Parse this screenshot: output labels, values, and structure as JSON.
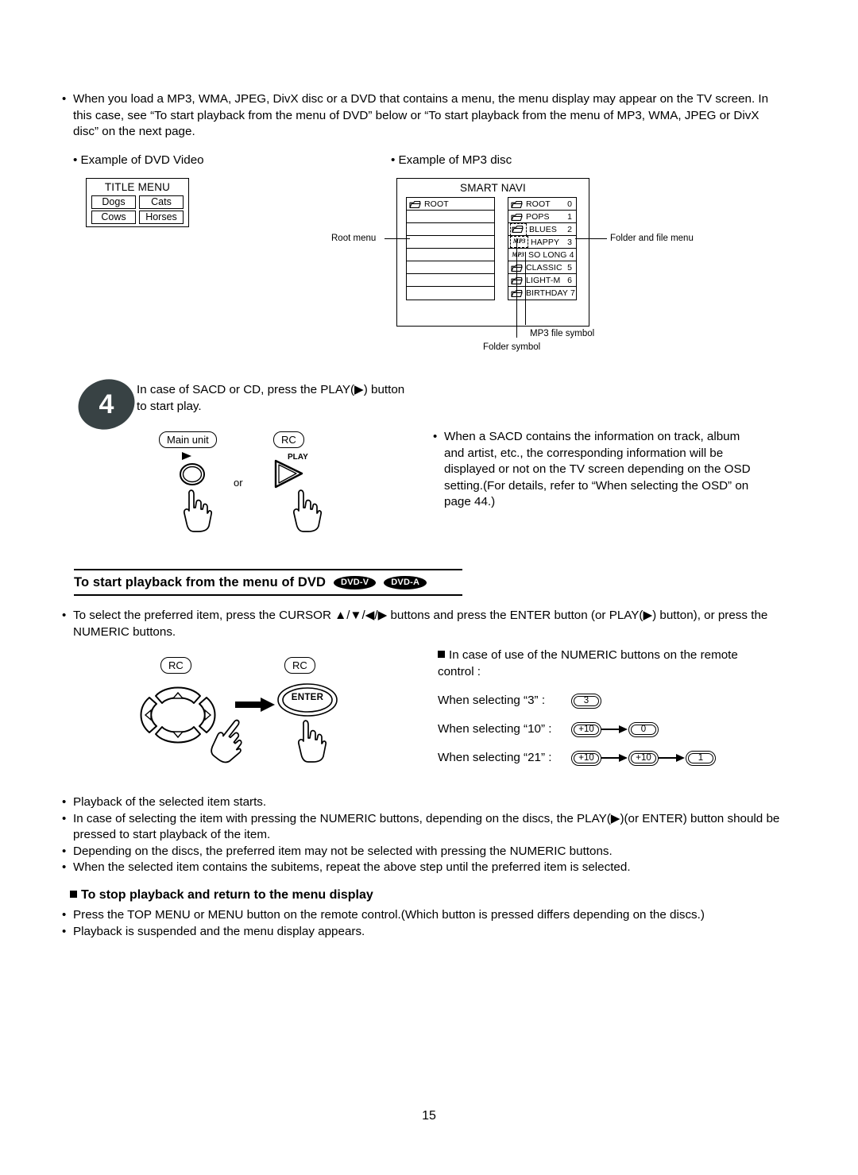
{
  "intro": {
    "bullet": "When you load a MP3, WMA, JPEG, DivX disc or a DVD that contains a menu, the menu display may appear on the TV screen. In this case, see “To start playback from the menu of DVD” below or “To start playback from the menu of MP3, WMA, JPEG or DivX disc” on the next page."
  },
  "examples": {
    "dvd_caption": "Example of DVD Video",
    "mp3_caption": "Example of MP3 disc"
  },
  "title_menu": {
    "heading": "TITLE MENU",
    "items": [
      "Dogs",
      "Cats",
      "Cows",
      "Horses"
    ]
  },
  "smart_navi": {
    "heading": "SMART NAVI",
    "root_menu_label": "Root menu",
    "folder_file_menu_label": "Folder and file menu",
    "mp3_file_symbol_label": "MP3 file symbol",
    "folder_symbol_label": "Folder symbol",
    "root_panel_rows": [
      {
        "label": "ROOT",
        "icon": "folder-icon"
      },
      {
        "label": "",
        "icon": ""
      },
      {
        "label": "",
        "icon": ""
      },
      {
        "label": "",
        "icon": ""
      },
      {
        "label": "",
        "icon": ""
      },
      {
        "label": "",
        "icon": ""
      },
      {
        "label": "",
        "icon": ""
      },
      {
        "label": "",
        "icon": ""
      }
    ],
    "file_panel_rows": [
      {
        "label": "ROOT",
        "num": "0",
        "icon": "folder-icon",
        "highlight": false
      },
      {
        "label": "POPS",
        "num": "1",
        "icon": "folder-icon",
        "highlight": false
      },
      {
        "label": "BLUES",
        "num": "2",
        "icon": "folder-icon",
        "highlight": true
      },
      {
        "label": "HAPPY",
        "num": "3",
        "icon": "mp3-file-icon",
        "highlight": true
      },
      {
        "label": "SO LONG",
        "num": "4",
        "icon": "mp3-file-icon",
        "highlight": false
      },
      {
        "label": "CLASSIC",
        "num": "5",
        "icon": "folder-icon",
        "highlight": false
      },
      {
        "label": "LIGHT-M",
        "num": "6",
        "icon": "folder-icon",
        "highlight": false
      },
      {
        "label": "BIRTHDAY",
        "num": "7",
        "icon": "folder-icon",
        "highlight": false
      }
    ],
    "mp3_tag_text": "MP3"
  },
  "step4": {
    "number": "4",
    "instruction": "In case of SACD or CD, press the PLAY(▶) button to start play.",
    "main_unit_label": "Main unit",
    "rc_label": "RC",
    "play_label": "PLAY",
    "or_label": "or"
  },
  "sacd_note": {
    "bullet": "When a SACD contains the information on track, album and artist, etc., the corresponding information will be displayed or not on the TV screen depending on the OSD setting.(For details, refer to “When selecting the OSD” on page 44.)"
  },
  "section": {
    "heading": "To start playback from the menu of DVD",
    "badges": [
      "DVD-V",
      "DVD-A"
    ]
  },
  "cursor_step": {
    "bullet": "To select the preferred item, press the CURSOR ▲/▼/◀/▶ buttons and press the ENTER button (or PLAY(▶) button), or press the NUMERIC buttons.",
    "rc_label_left": "RC",
    "rc_label_right": "RC",
    "enter_label": "ENTER"
  },
  "numeric": {
    "heading": "In case of use of the NUMERIC buttons on the remote control :",
    "rows": [
      {
        "label": "When selecting “3” :",
        "keys": [
          "3"
        ]
      },
      {
        "label": "When selecting “10” :",
        "keys": [
          "+10",
          "0"
        ]
      },
      {
        "label": "When selecting “21” :",
        "keys": [
          "+10",
          "+10",
          "1"
        ]
      }
    ]
  },
  "notes": {
    "items": [
      "Playback of the selected item starts.",
      "In case of selecting the item with pressing the NUMERIC buttons, depending on the discs, the PLAY(▶)(or ENTER) button should be pressed to start playback of the item.",
      "Depending on the discs, the preferred item may not be selected with pressing the NUMERIC buttons.",
      "When the selected item contains the subitems, repeat the above step until the preferred item is selected."
    ]
  },
  "stop_section": {
    "heading": "To stop playback and return to the menu display",
    "items": [
      "Press the TOP MENU or MENU button on the remote control.(Which button is pressed differs depending on the discs.)",
      "Playback is suspended and the menu display appears."
    ]
  },
  "footer": {
    "page_number": "15"
  }
}
